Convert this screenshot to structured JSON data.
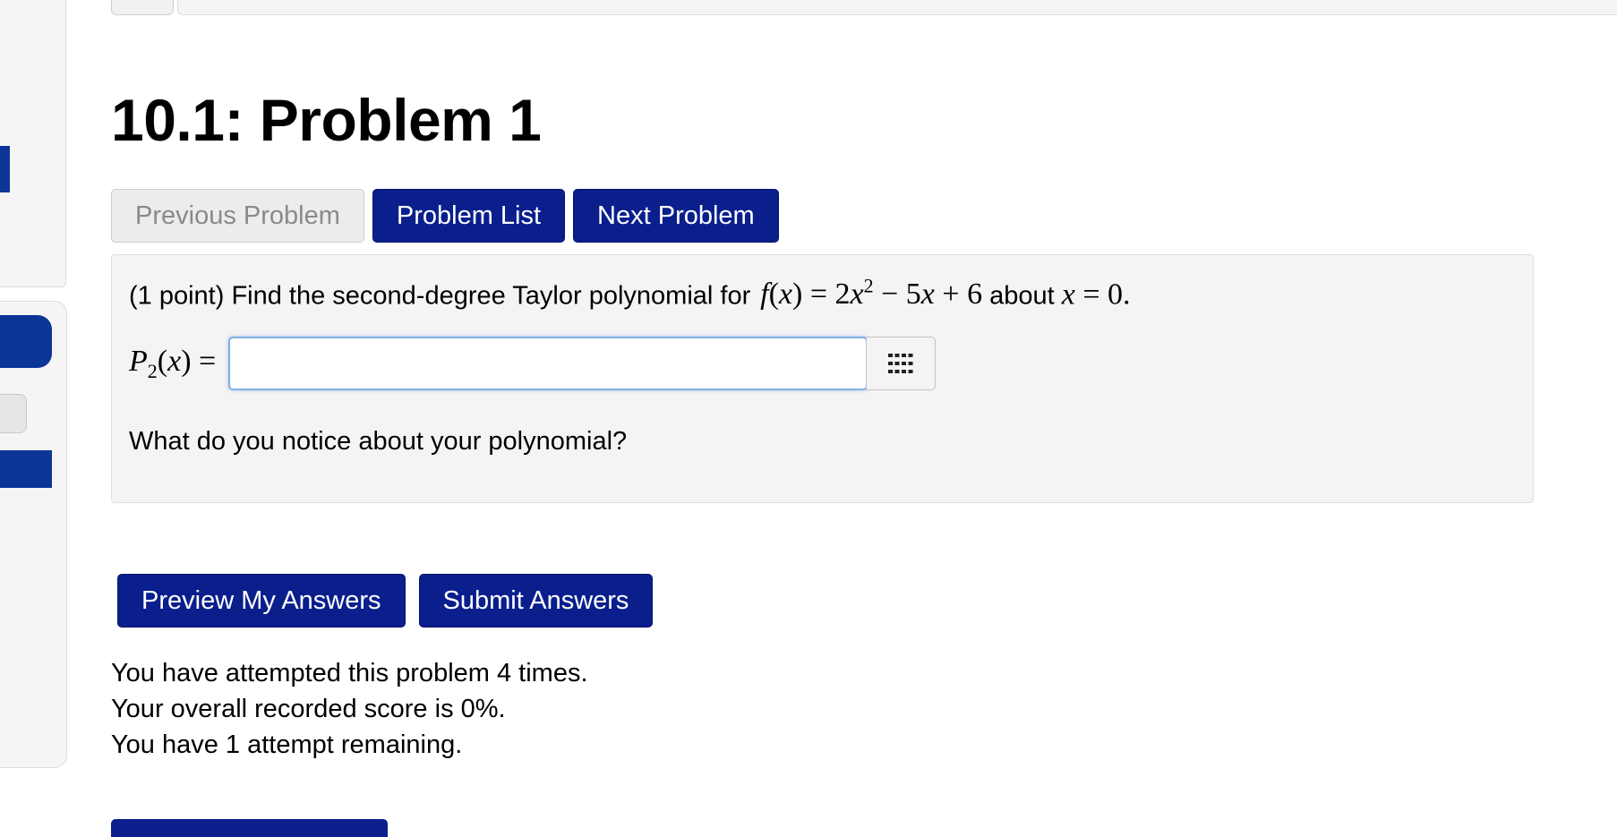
{
  "page": {
    "title": "10.1: Problem 1"
  },
  "nav": {
    "previous_label": "Previous Problem",
    "list_label": "Problem List",
    "next_label": "Next Problem"
  },
  "problem": {
    "points": "(1 point) Find the second-degree Taylor polynomial for",
    "about_text": "about",
    "answer_label_name": "P",
    "answer_label_sub": "2",
    "answer_value": "",
    "question": "What do you notice about your polynomial?"
  },
  "actions": {
    "preview_label": "Preview My Answers",
    "submit_label": "Submit Answers"
  },
  "status": {
    "attempts": "You have attempted this problem 4 times.",
    "score": "Your overall recorded score is 0%.",
    "remaining": "You have 1 attempt remaining."
  },
  "icons": {
    "answer_helper": "keyboard-grid-icon"
  },
  "colors": {
    "primary_button": "#0a1f8c",
    "sidebar_accent": "#0b3596",
    "problem_bg": "#f4f4f4"
  }
}
